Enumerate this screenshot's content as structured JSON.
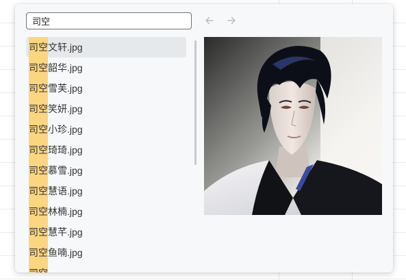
{
  "search": {
    "value": "司空",
    "placeholder": ""
  },
  "nav": {
    "back_icon": "arrow-left-icon",
    "forward_icon": "arrow-right-icon"
  },
  "highlight_color": "#fcd581",
  "selected_index": 0,
  "results": [
    {
      "match": "司空",
      "rest": "文轩.jpg"
    },
    {
      "match": "司空",
      "rest": "韶华.jpg"
    },
    {
      "match": "司空",
      "rest": "雪芙.jpg"
    },
    {
      "match": "司空",
      "rest": "笑妍.jpg"
    },
    {
      "match": "司空",
      "rest": "小珍.jpg"
    },
    {
      "match": "司空",
      "rest": "琦琦.jpg"
    },
    {
      "match": "司空",
      "rest": "慕雪.jpg"
    },
    {
      "match": "司空",
      "rest": "慧语.jpg"
    },
    {
      "match": "司空",
      "rest": "林楠.jpg"
    },
    {
      "match": "司空",
      "rest": "慧芊.jpg"
    },
    {
      "match": "司空",
      "rest": "鱼喃.jpg"
    },
    {
      "match": "司空",
      "rest": ""
    }
  ],
  "preview": {
    "subject": "portrait of dark-haired man in black and white robe"
  }
}
